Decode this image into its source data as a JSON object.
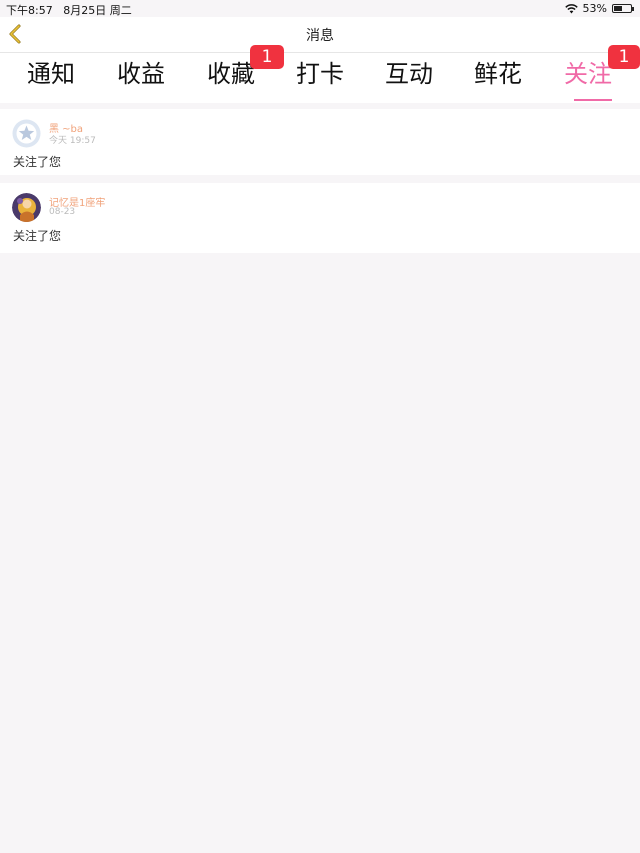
{
  "status_bar": {
    "time": "下午8:57",
    "date": "8月25日 周二",
    "battery": "53%",
    "battery_level": 0.53
  },
  "nav": {
    "title": "消息",
    "back_icon": "chevron-left-icon"
  },
  "tabs": [
    {
      "label": "通知",
      "badge": ""
    },
    {
      "label": "收益",
      "badge": ""
    },
    {
      "label": "收藏",
      "badge": "1"
    },
    {
      "label": "打卡",
      "badge": ""
    },
    {
      "label": "互动",
      "badge": ""
    },
    {
      "label": "鲜花",
      "badge": ""
    },
    {
      "label": "关注",
      "badge": "1",
      "active": true
    }
  ],
  "messages": [
    {
      "name": "黑 ~ba",
      "time": "今天 19:57",
      "text": "关注了您",
      "avatar": "default-avatar-icon"
    },
    {
      "name": "记忆是1座牢",
      "time": "08-23",
      "text": "关注了您",
      "avatar": "user-avatar"
    }
  ],
  "colors": {
    "accent": "#f06aa7",
    "badge": "#f0323f",
    "name": "#f0a27a",
    "back": "#d4a017"
  }
}
